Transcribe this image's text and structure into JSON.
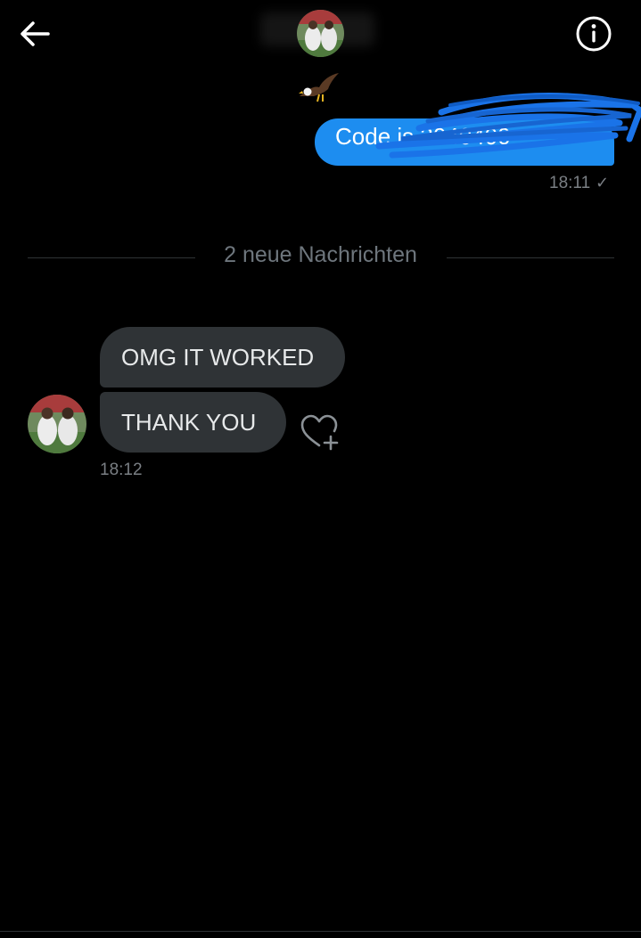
{
  "header": {
    "back_icon": "arrow-left-icon",
    "info_icon": "info-icon",
    "avatar": "avatar"
  },
  "messages": {
    "outgoing": {
      "text": "Code is 3040400",
      "time": "18:11",
      "status_icon": "checkmark-icon",
      "sticker_icon": "eagle-icon"
    },
    "divider": "2 neue Nachrichten",
    "incoming": {
      "bubbles": [
        "OMG IT WORKED",
        "THANK YOU"
      ],
      "time": "18:12",
      "reaction_icon": "heart-plus-icon"
    }
  },
  "colors": {
    "background": "#000000",
    "outgoing_bubble": "#1d8df0",
    "incoming_bubble": "#2f3336",
    "scribble": "#1a73e8",
    "muted_text": "#7a7f84"
  }
}
